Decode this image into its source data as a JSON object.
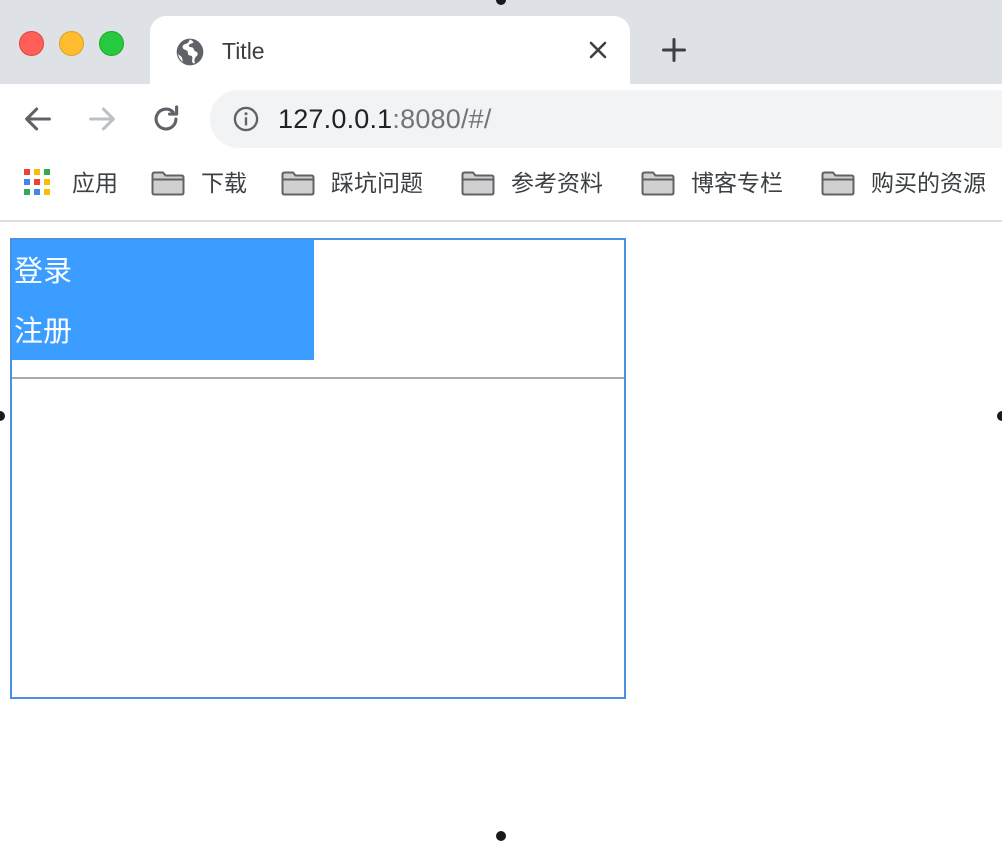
{
  "window": {
    "tab_title": "Title",
    "tab_favicon": "globe-icon",
    "new_tab_icon": "plus-icon"
  },
  "toolbar": {
    "url_host": "127.0.0.1",
    "url_rest": ":8080/#/",
    "site_info_icon": "info-icon"
  },
  "bookmarks": {
    "apps_label": "应用",
    "items": [
      {
        "label": "下载",
        "icon": "folder-icon"
      },
      {
        "label": "踩坑问题",
        "icon": "folder-icon"
      },
      {
        "label": "参考资料",
        "icon": "folder-icon"
      },
      {
        "label": "博客专栏",
        "icon": "folder-icon"
      },
      {
        "label": "购买的资源",
        "icon": "folder-icon"
      }
    ]
  },
  "page": {
    "menu": {
      "items": [
        {
          "label": "登录"
        },
        {
          "label": "注册"
        }
      ],
      "background": "#3a9dff"
    },
    "frame_border_color": "#4a90e2"
  }
}
